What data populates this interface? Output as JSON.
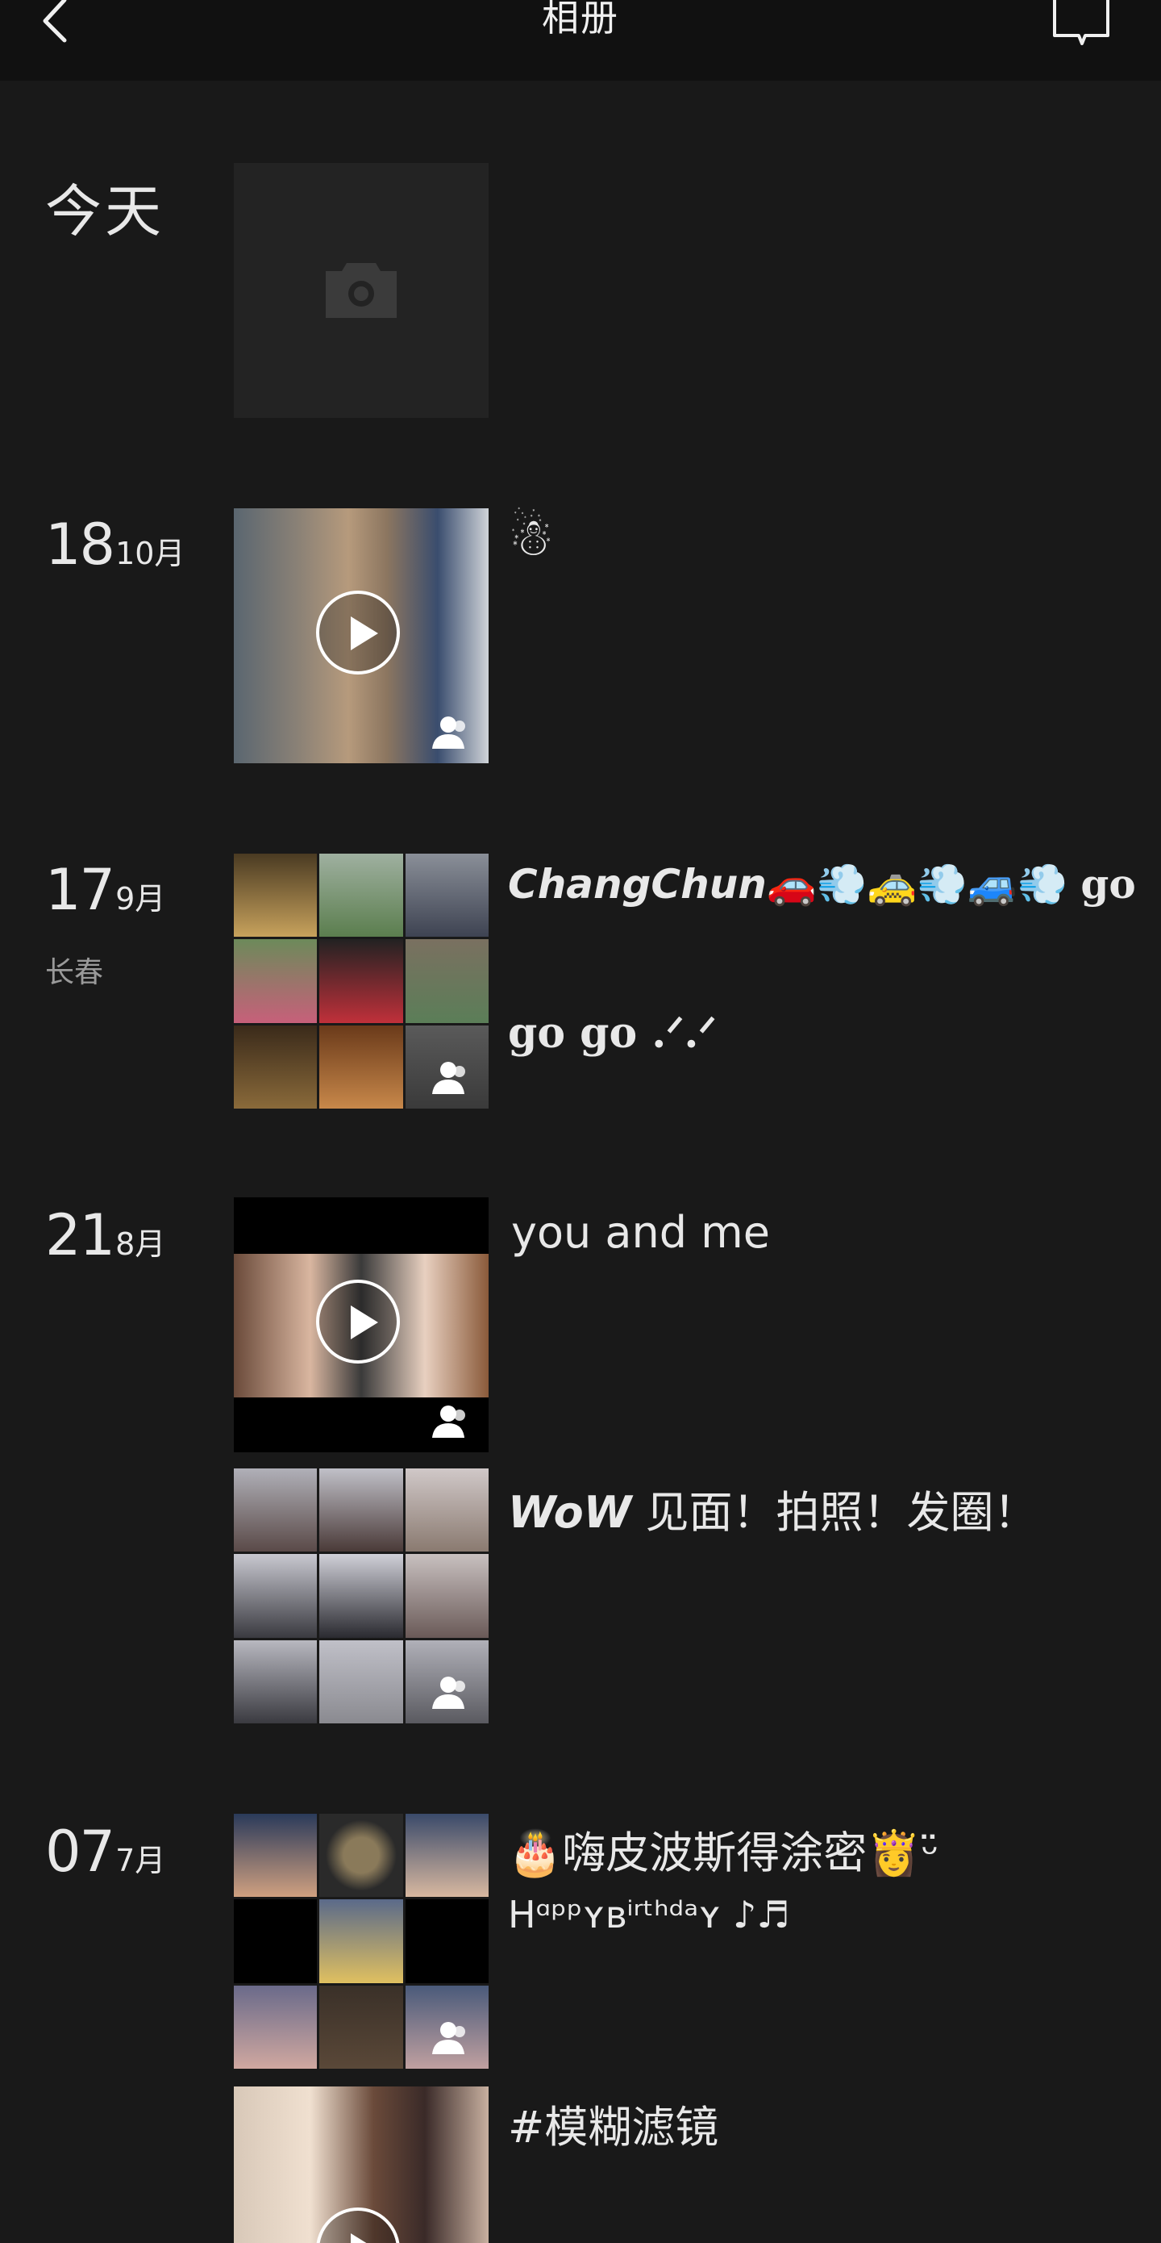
{
  "header": {
    "title": "相册"
  },
  "sections": [
    {
      "day_label": "今天"
    },
    {
      "day": "18",
      "month": "10月",
      "caption": "☃"
    },
    {
      "day": "17",
      "month": "9月",
      "location": "长春",
      "caption_line1_emph": "ChangChun",
      "caption_line1_emoji": "🚗💨🚕💨🚙💨",
      "caption_line1_tail": "go",
      "caption_line2": "go go .ᐟ.ᐟ"
    },
    {
      "day": "21",
      "month": "8月",
      "caption_1": "you and me",
      "caption_2_emph": "WoW",
      "caption_2_rest": "见面！拍照！发圈！"
    },
    {
      "day": "07",
      "month": "7月",
      "caption_1": "🎂嗨皮波斯得涂密👸ᵕ̈",
      "caption_1_line2": "Hᵅᵖᵖʏʙⁱʳᵗʰᵈᵃʏ ♪♬",
      "caption_2": "#模糊滤镜"
    }
  ],
  "colors": {
    "background": "#191919",
    "header_bg": "#111111",
    "text": "#e8e8e8",
    "subtext": "#9a9a9a"
  },
  "icons": [
    "back-chevron-icon",
    "message-icon",
    "camera-icon",
    "play-icon",
    "person-icon"
  ]
}
